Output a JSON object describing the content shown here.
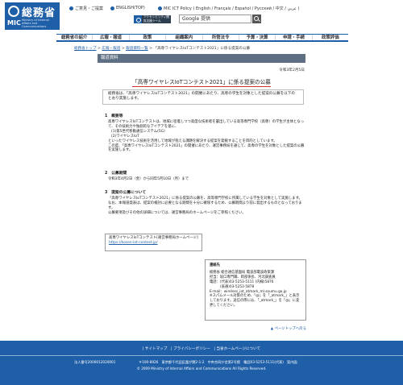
{
  "header": {
    "logo_title": "総務省",
    "logo_mic": "MIC",
    "logo_sub": "Ministry of Internal Affairs and Communications",
    "links": [
      {
        "label": "ご意見・ご提案"
      },
      {
        "label": "ENGLISH(TOP)"
      },
      {
        "label": "MIC ICT Policy ( English / Français / Español / Русский / 中文 / عربي )"
      }
    ],
    "accessibility_label": "アクセシビリティ閲覧支援ツール",
    "search_value": "Google 提供",
    "brand_color": "#1f5fa8"
  },
  "nav": {
    "items": [
      {
        "label": "総務省の紹介"
      },
      {
        "label": "広報・報道"
      },
      {
        "label": "政策"
      },
      {
        "label": "組織案内"
      },
      {
        "label": "所管法令"
      },
      {
        "label": "予算・決算"
      },
      {
        "label": "申請・手続"
      },
      {
        "label": "政策評価"
      }
    ]
  },
  "breadcrumb": {
    "items": [
      {
        "label": "総務省トップ"
      },
      {
        "label": "広報・報道"
      },
      {
        "label": "報道資料一覧"
      }
    ],
    "current": "「高専ワイヤレスIoTコンテスト2021」に係る提案の公募"
  },
  "main": {
    "section_title": "報道資料",
    "date": "令和3年2月5日",
    "heading": "「高専ワイヤレスIoTコンテスト2021」に係る提案の公募",
    "intro": "総務省は、「高専ワイヤレスIoTコンテスト2021」の開催にあたり、高専の学生を対象とした提案の公募を以下のとおり実施します。",
    "sections": [
      {
        "title": "1　概要等",
        "lines": [
          "高専ワイヤレスIoTコンテストは、地域に密着しつつ高度な技術者を輩出している高等専門学校（高専）の学生が主体となって、その技術力や独創的なアイデアを基に、",
          "(1)第5世代移動通信システム(5G)",
          "(2)ワイヤレスIoT",
          "といったワイヤレス技術を活用して地域が抱える課題を解決する提案を発掘することを目的としています。",
          "この度、「高専ワイヤレスIoTコンテスト2021」の開催にあたり、運営事務局を通じて、高専の学生を対象とした提案の公募を実施します。"
        ]
      },
      {
        "title": "2　公募期間",
        "lines": [
          "令和3年4月2日（金）から同年5月10日（月）まで"
        ]
      },
      {
        "title": "3　提案の公募について",
        "lines": [
          "「高専ワイヤレスIoTコンテスト2021」に係る提案の公募を、高等専門学校に所属している学生を対象として実施します。",
          "なお、本報道発表は、提案の検討に必要となる期間を十分に確保するため、公募期間より前に発出するものとなっております。",
          "公募要項及びその他の詳細については、運営事務局のホームページをご参照ください。"
        ]
      }
    ],
    "info_box": {
      "label": "高専ワイヤレスIoTコンテスト[運営事務局ホームページ]",
      "url": "https://kosen-iot-contest.jp/"
    },
    "contact": {
      "title": "連絡先",
      "lines": [
        "総務省 総合通信基盤局 電波部電波政策課",
        "担当：坂口専門職、岡部係長、河北調査員",
        "電話：(代表)03-5253-5111 (内線)5876",
        "　　　(直通)03-5253-5878",
        "E-mail：wireless_iot_atmark_ml.soumu.go.jp",
        "※スパムメール対策のため、「@」を「_atmark_」と表示しております。送信の際には、「_atmark_」を「@」に変更してください。"
      ]
    },
    "page_top": "▲ ページトップへ戻る"
  },
  "footer": {
    "links": "| サイトマップ　| プライバシーポリシー　| 当省ホームページについて",
    "corp_number": "法人番号2000012020001",
    "address": "〒100-8926　東京都千代田区霞が関2-1-2　中央合同庁舎第2号館　電話03-5253-5111(代表)　案内図",
    "copyright": "© 2009 Ministry of Internal Affairs and Communications All Rights Reserved."
  }
}
